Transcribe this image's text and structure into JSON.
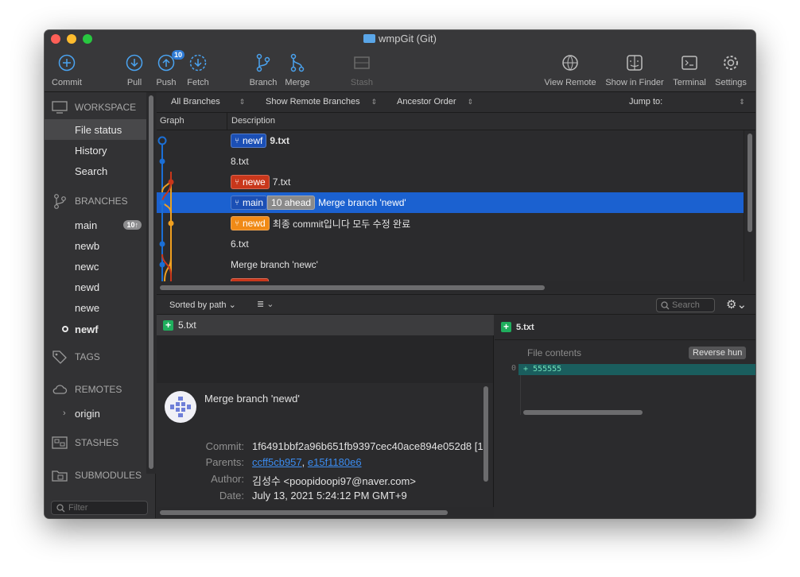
{
  "window": {
    "title": "wmpGit (Git)"
  },
  "toolbar": {
    "commit": "Commit",
    "pull": "Pull",
    "push": "Push",
    "push_badge": "10",
    "fetch": "Fetch",
    "branch": "Branch",
    "merge": "Merge",
    "stash": "Stash",
    "view_remote": "View Remote",
    "show_in_finder": "Show in Finder",
    "terminal": "Terminal",
    "settings": "Settings"
  },
  "sidebar": {
    "workspace": "WORKSPACE",
    "workspace_items": [
      "File status",
      "History",
      "Search"
    ],
    "branches_head": "BRANCHES",
    "branches": [
      {
        "name": "main",
        "count": "10↑"
      },
      {
        "name": "newb"
      },
      {
        "name": "newc"
      },
      {
        "name": "newd"
      },
      {
        "name": "newe"
      },
      {
        "name": "newf",
        "current": true
      }
    ],
    "tags": "TAGS",
    "remotes": "REMOTES",
    "remote_origin": "origin",
    "stashes": "STASHES",
    "submodules": "SUBMODULES",
    "filter_placeholder": "Filter"
  },
  "filters": {
    "branches": "All Branches",
    "remote": "Show Remote Branches",
    "order": "Ancestor Order",
    "jump": "Jump to:"
  },
  "columns": {
    "graph": "Graph",
    "description": "Description"
  },
  "commits": [
    {
      "refs": [
        {
          "name": "newf",
          "color": "blue"
        }
      ],
      "message": "9.txt",
      "bold": true
    },
    {
      "refs": [],
      "message": "8.txt"
    },
    {
      "refs": [
        {
          "name": "newe",
          "color": "red"
        }
      ],
      "message": "7.txt"
    },
    {
      "refs": [
        {
          "name": "main",
          "color": "blue"
        }
      ],
      "ahead": "10 ahead",
      "message": "Merge branch 'newd'",
      "selected": true
    },
    {
      "refs": [
        {
          "name": "newd",
          "color": "orange"
        }
      ],
      "message": "최종 commit입니다 모두 수정 완료"
    },
    {
      "refs": [],
      "message": "6.txt"
    },
    {
      "refs": [],
      "message": "Merge branch 'newc'"
    }
  ],
  "lower": {
    "sort": "Sorted by path",
    "search_placeholder": "Search"
  },
  "files": [
    {
      "name": "5.txt",
      "status": "added"
    }
  ],
  "commit_info": {
    "message": "Merge branch 'newd'",
    "commit_label": "Commit:",
    "commit": "1f6491bbf2a96b651fb9397cec40ace894e052d8 [1",
    "parents_label": "Parents:",
    "parent1": "ccff5cb957",
    "parent2": "e15f1180e6",
    "author_label": "Author:",
    "author": "김성수 <poopidoopi97@naver.com>",
    "date_label": "Date:",
    "date": "July 13, 2021 5:24:12 PM GMT+9"
  },
  "diff": {
    "file": "5.txt",
    "hunk_title": "File contents",
    "reverse": "Reverse hun",
    "lines": [
      {
        "num": "0",
        "text": "+  555555"
      }
    ]
  },
  "colors": {
    "accent": "#1b61d0",
    "branch_blue": "#1b4fb5",
    "branch_red": "#c9371b",
    "branch_orange": "#f08a16",
    "added": "#1fae5d"
  }
}
